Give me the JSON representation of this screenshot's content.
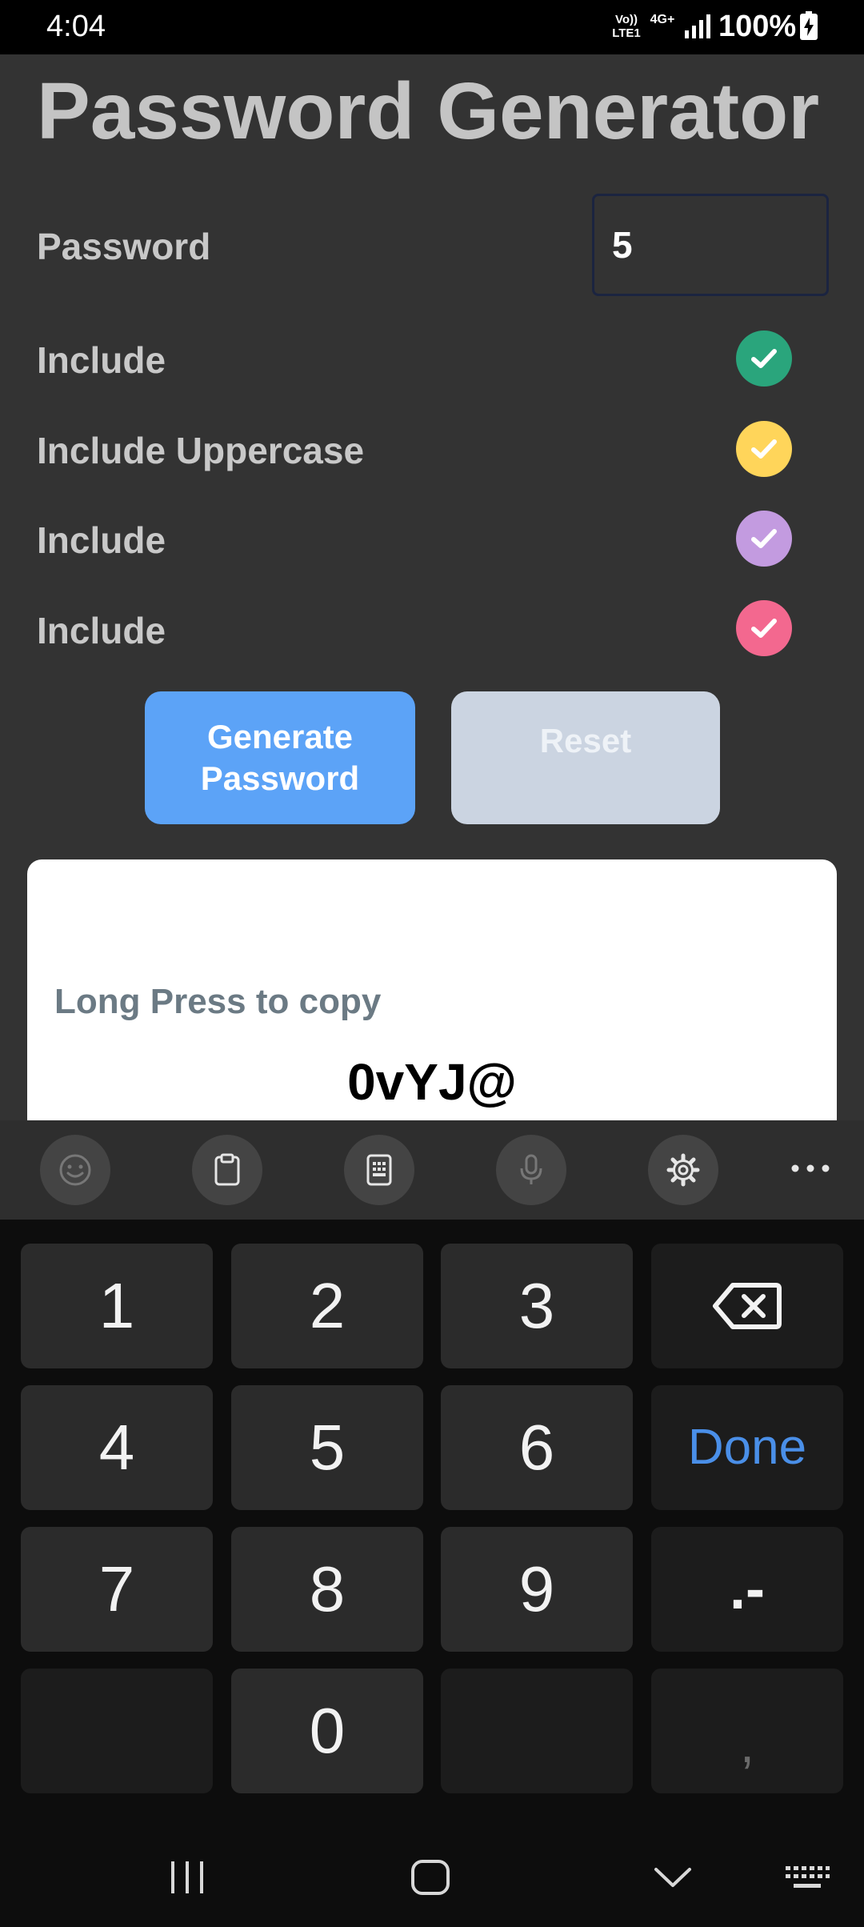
{
  "status_bar": {
    "time": "4:04",
    "volte_label": "Vo)) LTE1",
    "network": "4G+",
    "battery_percent": "100%"
  },
  "app": {
    "title": "Password Generator",
    "length_label": "Password",
    "length_value": "5",
    "options": [
      {
        "label": "Include",
        "checked": true,
        "color": "#2aa57c"
      },
      {
        "label": "Include Uppercase",
        "checked": true,
        "color": "#ffd55a"
      },
      {
        "label": "Include",
        "checked": true,
        "color": "#c39be0"
      },
      {
        "label": "Include",
        "checked": true,
        "color": "#f3688f"
      }
    ],
    "generate_button": "Generate Password",
    "reset_button": "Reset",
    "copy_hint": "Long Press to copy",
    "password": "0vYJ@"
  },
  "keyboard": {
    "toolbar_icons": [
      "emoji-icon",
      "clipboard-icon",
      "keypad-icon",
      "microphone-icon",
      "settings-icon",
      "more-icon"
    ],
    "keys": {
      "k1": "1",
      "k2": "2",
      "k3": "3",
      "k4": "4",
      "k5": "5",
      "k6": "6",
      "k7": "7",
      "k8": "8",
      "k9": "9",
      "k0": "0",
      "done": "Done",
      "dot_dash": ".-",
      "comma": ","
    }
  },
  "colors": {
    "background": "#333333",
    "accent_blue": "#5ca3f7",
    "done_blue": "#4a8fe8"
  }
}
